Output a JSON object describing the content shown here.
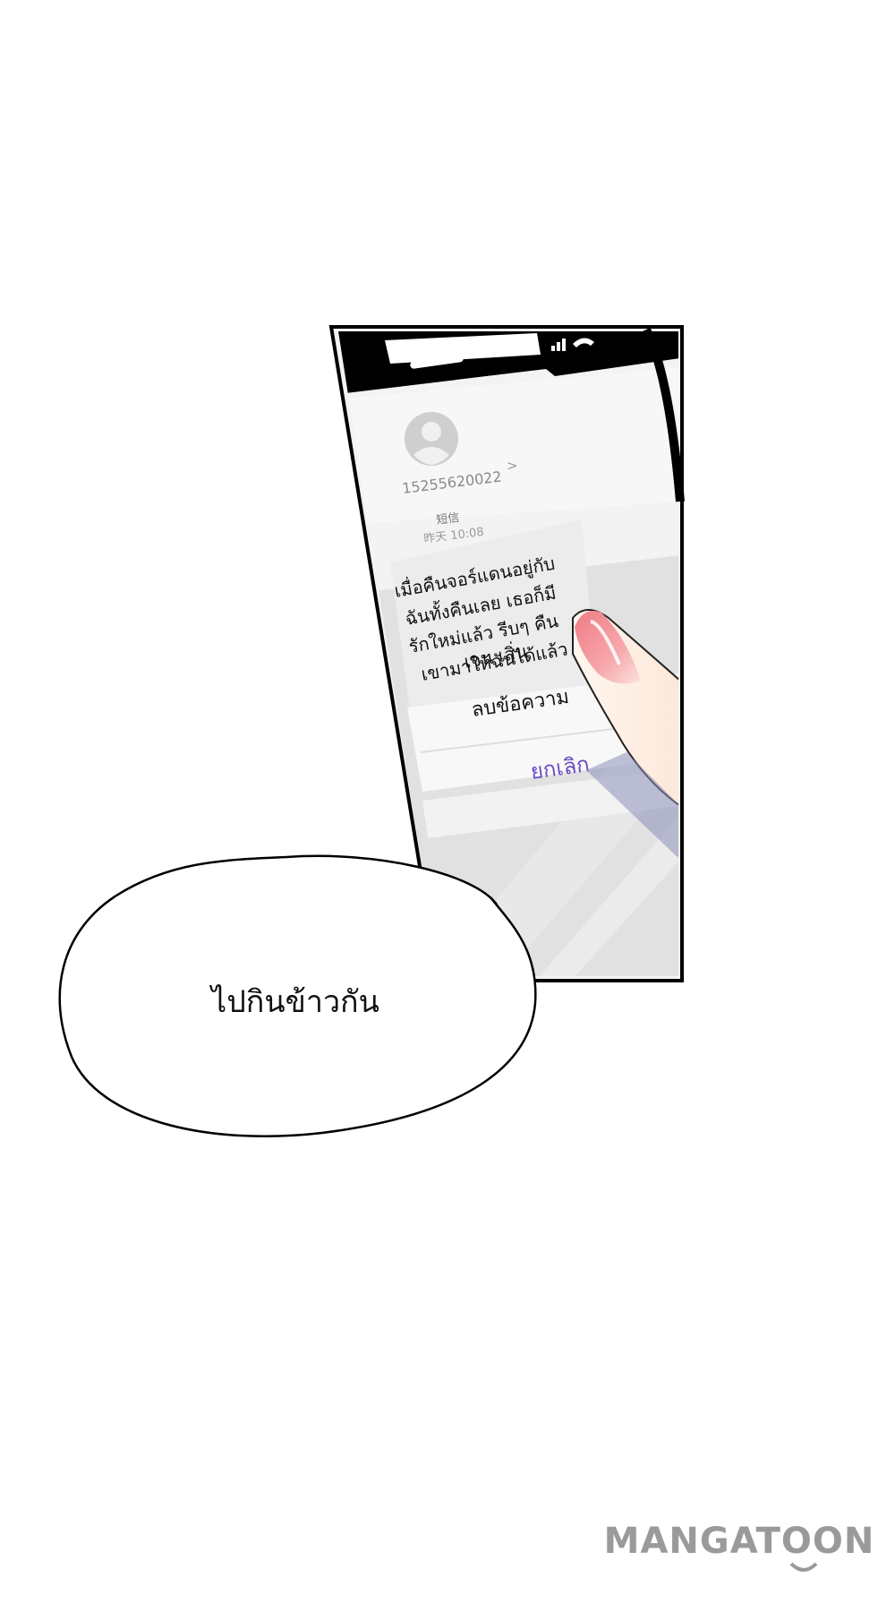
{
  "phone": {
    "contact_number": "15255620022",
    "thread_label": "短信",
    "thread_time": "昨天 10:08",
    "message_lines": [
      "เมื่อคืนจอร์แดนอยู่กับ",
      "ฉันทั้งคืนเลย เธอก็มี",
      "รักใหม่แล้ว รีบๆ คืน",
      "เขามาให้ฉันได้แล้ว",
      "เจน เสิ่น"
    ],
    "delete_option": "ลบข้อความ",
    "cancel_option": "ยกเลิก"
  },
  "speech_bubble": {
    "text": "ไปกินข้าวกัน"
  },
  "watermark": {
    "text": "MANGATOON"
  },
  "colors": {
    "cancel_text": "#6a4bc4",
    "phone_frame": "#000000",
    "watermark": "#9a9a9a",
    "finger_nail": "#f29a9f"
  }
}
